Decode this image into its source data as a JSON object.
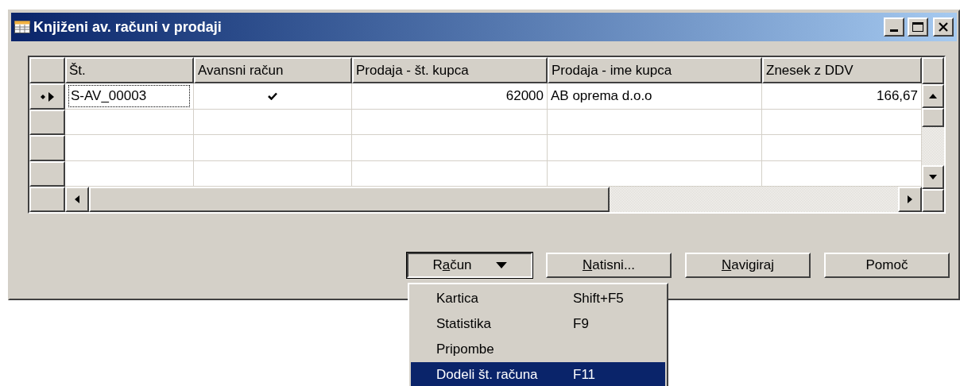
{
  "window": {
    "title": "Knjiženi av. računi v prodaji"
  },
  "table": {
    "columns": [
      "Št.",
      "Avansni račun",
      "Prodaja - št. kupca",
      "Prodaja - ime kupca",
      "Znesek z DDV"
    ],
    "rows": [
      {
        "selected": true,
        "number": "S-AV_00003",
        "advance_invoice": true,
        "customer_no": "62000",
        "customer_name": "AB oprema d.o.o",
        "amount": "166,67"
      }
    ]
  },
  "buttons": [
    {
      "label_before": "R",
      "access_key": "a",
      "label_after": "čun",
      "kind": "dropdown",
      "expanded": true
    },
    {
      "access_key": "N",
      "label_after": "atisni...",
      "kind": "plain"
    },
    {
      "access_key": "N",
      "label_after": "avigiraj",
      "kind": "plain"
    },
    {
      "label_after": "Pomoč",
      "kind": "plain"
    }
  ],
  "menu": {
    "items": [
      {
        "label": "Kartica",
        "shortcut": "Shift+F5",
        "selected": false
      },
      {
        "label": "Statistika",
        "shortcut": "F9",
        "selected": false
      },
      {
        "label": "Pripombe",
        "selected": false
      },
      {
        "label": "Dodeli št. računa",
        "shortcut": "F11",
        "selected": true
      }
    ]
  }
}
